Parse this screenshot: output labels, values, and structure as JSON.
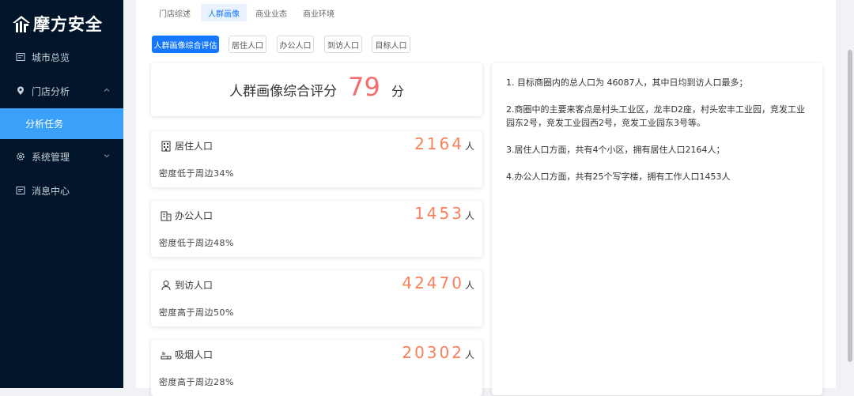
{
  "app": {
    "logo_text": "摩方安全"
  },
  "sidebar": {
    "items": [
      {
        "label": "城市总览",
        "icon": "dashboard-icon"
      },
      {
        "label": "门店分析",
        "icon": "location-icon"
      },
      {
        "label": "分析任务"
      },
      {
        "label": "系统管理",
        "icon": "gear-icon"
      },
      {
        "label": "消息中心",
        "icon": "message-icon"
      }
    ],
    "active_sub": "分析任务"
  },
  "top_tabs": [
    {
      "label": "门店综述"
    },
    {
      "label": "人群画像",
      "active": true
    },
    {
      "label": "商业业态"
    },
    {
      "label": "商业环境"
    }
  ],
  "sub_tabs": [
    {
      "label": "人群画像综合评估",
      "active": true
    },
    {
      "label": "居住人口"
    },
    {
      "label": "办公人口"
    },
    {
      "label": "到访人口"
    },
    {
      "label": "目标人口"
    }
  ],
  "score": {
    "label": "人群画像综合评分",
    "value": "79",
    "unit": "分"
  },
  "stats": [
    {
      "title": "居住人口",
      "value": "2164",
      "unit": "人",
      "desc": "密度低于周边34%",
      "icon": "building-icon"
    },
    {
      "title": "办公人口",
      "value": "1453",
      "unit": "人",
      "desc": "密度低于周边48%",
      "icon": "office-icon"
    },
    {
      "title": "到访人口",
      "value": "42470",
      "unit": "人",
      "desc": "密度高于周边50%",
      "icon": "person-icon"
    },
    {
      "title": "吸烟人口",
      "value": "20302",
      "unit": "人",
      "desc": "密度高于周边28%",
      "icon": "cigarette-icon"
    }
  ],
  "summary": [
    "1. 目标商圈内的总人口为 46087人，其中日均到访人口最多；",
    "2.商圈中的主要来客点是村头工业区，龙丰D2座，村头宏丰工业园，竞发工业园东2号，竞发工业园西2号，竞发工业园东3号等。",
    "3.居住人口方面，共有4个小区，拥有居住人口2164人；",
    "4.办公人口方面，共有25个写字楼，拥有工作人口1453人"
  ],
  "colors": {
    "sidebar_bg": "#001529",
    "accent": "#1677ff",
    "active_menu": "#3ba1f8",
    "number": "#f6815a",
    "score": "#f56c6c"
  }
}
